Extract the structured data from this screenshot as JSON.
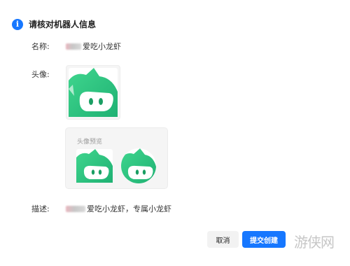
{
  "dialog": {
    "title": "请核对机器人信息",
    "name_label": "名称:",
    "name_value": "爱吃小龙虾",
    "avatar_label": "头像:",
    "preview_title": "头像预览",
    "desc_label": "描述:",
    "desc_value": "爱吃小龙虾，专属小龙虾",
    "cancel_label": "取消",
    "submit_label": "提交创建"
  },
  "watermark": "游侠网",
  "colors": {
    "accent": "#1677ff",
    "avatar_green": "#23c37c",
    "avatar_green_light": "#3fd68e"
  }
}
